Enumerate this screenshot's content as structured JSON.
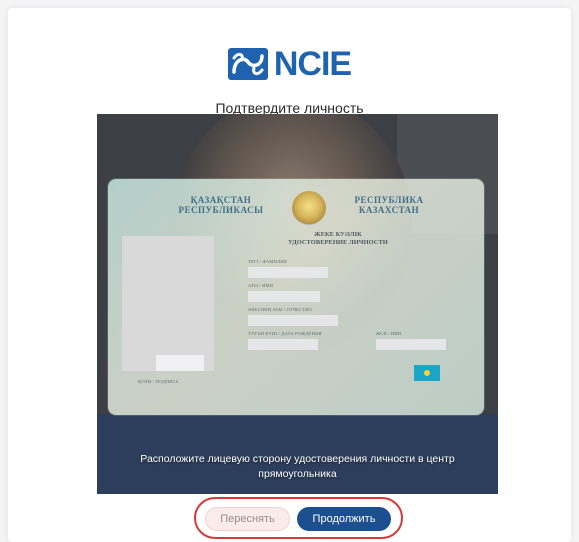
{
  "brand": {
    "logo_text": "NCIE",
    "logo_icon": "ncie-logo-icon",
    "color": "#1f63b0"
  },
  "page": {
    "title": "Подтвердите личность"
  },
  "camera": {
    "id_card": {
      "header_left": "ҚАЗАҚСТАН\nРЕСПУБЛИКАСЫ",
      "header_right": "РЕСПУБЛИКА\nКАЗАХСТАН",
      "doc_title": "ЖЕКЕ КУӘЛІК\nУДОСТОВЕРЕНИЕ ЛИЧНОСТИ",
      "fields": [
        "ТЕГІ / ФАМИЛИЯ",
        "АТЫ / ИМЯ",
        "ӘКЕСІНІҢ АТЫ / ОТЧЕСТВО",
        "ТУҒАН КҮНІ / ДАТА РОЖДЕНИЯ",
        "ЖСН / ИИН"
      ],
      "signature_label": "ҚОЛЫ / ПОДПИСЬ"
    },
    "hint": "Расположите лицевую сторону удостоверения личности в центр прямоугольника"
  },
  "actions": {
    "retake_label": "Переснять",
    "continue_label": "Продолжить",
    "highlight_color": "#d63939",
    "primary_color": "#1c4f8f"
  }
}
